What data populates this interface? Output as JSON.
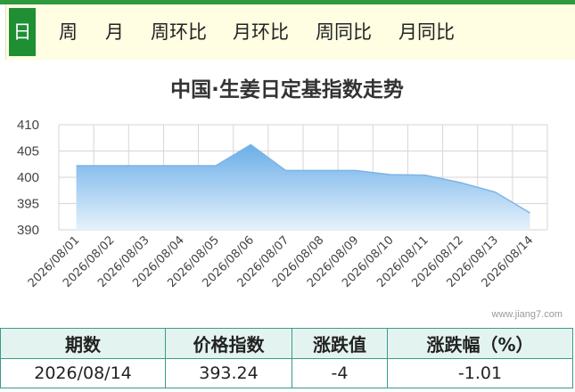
{
  "tabs": [
    {
      "label": "日",
      "active": true
    },
    {
      "label": "周"
    },
    {
      "label": "月"
    },
    {
      "label": "周环比"
    },
    {
      "label": "月环比"
    },
    {
      "label": "周同比"
    },
    {
      "label": "月同比"
    }
  ],
  "chart_data": {
    "type": "area",
    "title": "中国·生姜日定基指数走势",
    "x": [
      "2026/08/01",
      "2026/08/02",
      "2026/08/03",
      "2026/08/04",
      "2026/08/05",
      "2026/08/06",
      "2026/08/07",
      "2026/08/08",
      "2026/08/09",
      "2026/08/10",
      "2026/08/11",
      "2026/08/12",
      "2026/08/13",
      "2026/08/14"
    ],
    "series": [
      {
        "values": [
          402.2,
          402.2,
          402.2,
          402.2,
          402.2,
          406.2,
          401.3,
          401.3,
          401.3,
          400.5,
          400.4,
          399.0,
          397.2,
          393.24
        ]
      }
    ],
    "yticks": [
      390,
      395,
      400,
      405,
      410
    ],
    "ylim": [
      390,
      410
    ],
    "grid": true,
    "colors": {
      "line": "#7db4e6",
      "fill_top": "#6aaee8",
      "fill_bottom": "#e6f1fb"
    }
  },
  "watermark": "www.jiang7.com",
  "summary": {
    "headers": [
      "期数",
      "价格指数",
      "涨跌值",
      "涨跌幅（%）"
    ],
    "row": [
      "2026/08/14",
      "393.24",
      "-4",
      "-1.01"
    ]
  }
}
